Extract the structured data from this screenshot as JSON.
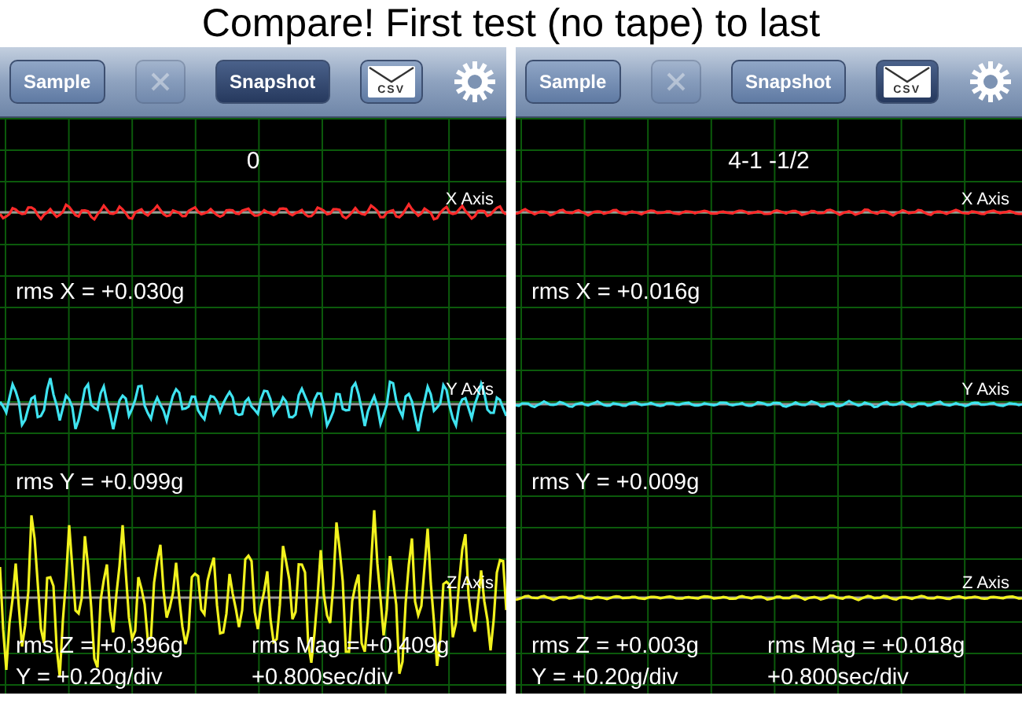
{
  "title": "Compare! First test (no tape) to last",
  "panels": [
    {
      "toolbar": [
        {
          "kind": "text",
          "label": "Sample",
          "selected": false,
          "disabled": false
        },
        {
          "kind": "close",
          "selected": false,
          "disabled": true
        },
        {
          "kind": "text",
          "label": "Snapshot",
          "selected": true,
          "disabled": false
        },
        {
          "kind": "csv",
          "label": "CSV",
          "selected": false,
          "disabled": false
        },
        {
          "kind": "settings"
        }
      ],
      "caption": "0",
      "channels": [
        {
          "label": "X Axis",
          "color": "#ff2a2a",
          "readouts": [
            "rms X = +0.030g"
          ]
        },
        {
          "label": "Y Axis",
          "color": "#3fe3f0",
          "readouts": [
            "rms Y = +0.099g"
          ]
        },
        {
          "label": "Z Axis",
          "color": "#f2f21e",
          "readouts": [
            "rms Z = +0.396g",
            "rms Mag = +0.409g"
          ]
        }
      ],
      "scale": [
        "Y = +0.20g/div",
        "+0.800sec/div"
      ]
    },
    {
      "toolbar": [
        {
          "kind": "text",
          "label": "Sample",
          "selected": false,
          "disabled": false
        },
        {
          "kind": "close",
          "selected": false,
          "disabled": true
        },
        {
          "kind": "text",
          "label": "Snapshot",
          "selected": false,
          "disabled": false
        },
        {
          "kind": "csv",
          "label": "CSV",
          "selected": true,
          "disabled": false
        },
        {
          "kind": "settings"
        }
      ],
      "caption": "4-1 -1/2",
      "channels": [
        {
          "label": "X Axis",
          "color": "#ff2a2a",
          "readouts": [
            "rms X = +0.016g"
          ]
        },
        {
          "label": "Y Axis",
          "color": "#3fe3f0",
          "readouts": [
            "rms Y = +0.009g"
          ]
        },
        {
          "label": "Z Axis",
          "color": "#f2f21e",
          "readouts": [
            "rms Z = +0.003g",
            "rms Mag = +0.018g"
          ]
        }
      ],
      "scale": [
        "Y = +0.20g/div",
        "+0.800sec/div"
      ]
    }
  ]
}
